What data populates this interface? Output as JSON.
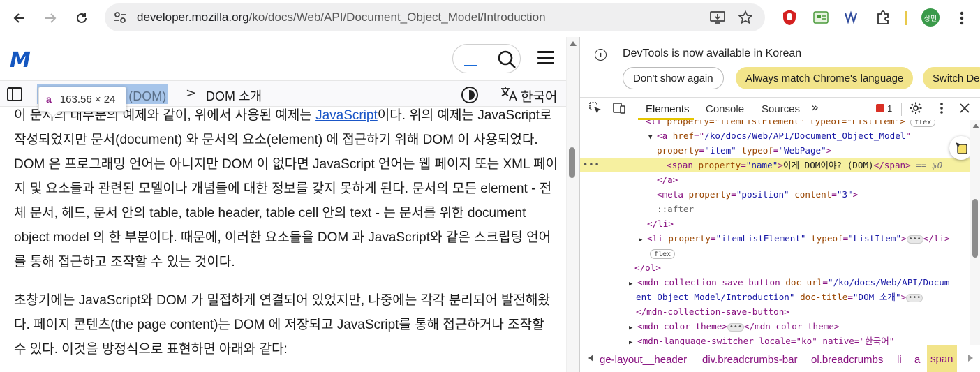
{
  "browser": {
    "url_host": "developer.mozilla.org",
    "url_path": "/ko/docs/Web/API/Document_Object_Model/Introduction",
    "avatar_text": "상민"
  },
  "page": {
    "logo_text": "M",
    "tooltip": {
      "tag": "a",
      "size": "163.56 × 24"
    },
    "breadcrumb": {
      "item1": "이게 DOM이야? (DOM)",
      "separator": ">",
      "item2": "DOM 소개"
    },
    "language_label": "한국어",
    "paragraph1": {
      "before_link": "이 문서의 대부분의 예제와 같이, 위에서 사용된 예제는 ",
      "link": "JavaScript",
      "after_link": "이다. 위의 예제는 JavaScript로 작성되었지만 문서(document) 와 문서의 요소(element) 에 접근하기 위해 DOM 이 사용되었다. DOM 은 프로그래밍 언어는 아니지만 DOM 이 없다면 JavaScript 언어는 웹 페이지 또는 XML 페이지 및 요소들과 관련된 모델이나 개념들에 대한 정보를 갖지 못하게 된다. 문서의 모든 element - 전체 문서, 헤드, 문서 안의 table, table header, table cell 안의 text - 는 문서를 위한 document object model 의 한 부분이다. 때문에, 이러한 요소들을 DOM 과 JavaScript와 같은 스크립팅 언어를 통해 접근하고 조작할 수 있는 것이다."
    },
    "paragraph2": "초창기에는 JavaScript와 DOM 가 밀접하게 연결되어 있었지만, 나중에는 각각 분리되어 발전해왔다. 페이지 콘텐츠(the page content)는 DOM 에 저장되고 JavaScript를 통해 접근하거나 조작할 수 있다. 이것을 방정식으로 표현하면 아래와 같다:"
  },
  "devtools": {
    "info_text": "DevTools is now available in Korean",
    "btn_dont_show": "Don't show again",
    "btn_always_match": "Always match Chrome's language",
    "btn_switch": "Switch De",
    "tabs": [
      "Elements",
      "Console",
      "Sources"
    ],
    "more_tabs": "»",
    "error_count": "1",
    "code": {
      "l0_tag": "<li",
      "l0_rest": " property=\"itemListElement\" typeof=\"ListItem\">",
      "l0_badge": "flex",
      "l1_open": "<a",
      "l1_attr1": " href",
      "l1_val1": "/ko/docs/Web/API/Document_Object_Model",
      "l2_attr1": "property",
      "l2_val1": "\"item\"",
      "l2_attr2": "typeof",
      "l2_val2": "\"WebPage\"",
      "l3_open": "<span",
      "l3_attr": "property",
      "l3_val": "\"name\"",
      "l3_text": "이게 DOM이야? (DOM)",
      "l3_close": "</span>",
      "l3_eq": "== $0",
      "l4": "</a>",
      "l5_open": "<meta",
      "l5_attr1": "property",
      "l5_val1": "\"position\"",
      "l5_attr2": "content",
      "l5_val2": "\"3\"",
      "l6": "::after",
      "l7": "</li>",
      "l8_open": "<li",
      "l8_attr1": "property",
      "l8_val1": "\"itemListElement\"",
      "l8_attr2": "typeof",
      "l8_val2": "\"ListItem\"",
      "l8_close": "</li>",
      "l9_badge": "flex",
      "l10": "</ol>",
      "l11_open": "<mdn-collection-save-button",
      "l11_attr1": "doc-url",
      "l11_val1": "\"/ko/docs/Web/API/Docum",
      "l12_val1": "ent_Object_Model/Introduction\"",
      "l12_attr2": "doc-title",
      "l12_val2": "\"DOM 소개\"",
      "l13": "</mdn-collection-save-button>",
      "l14_open": "<mdn-color-theme>",
      "l14_close": "</mdn-color-theme>",
      "l15": "<mdn-language-switcher locale=\"ko\" native=\"한국어\""
    },
    "crumbs": [
      "ge-layout__header",
      "div.breadcrumbs-bar",
      "ol.breadcrumbs",
      "li",
      "a",
      "span"
    ],
    "colors": {
      "selection": "#f6f0a0",
      "tag": "#881280",
      "attr_name": "#994500",
      "attr_value": "#1a1aa6",
      "accent": "#e5c500"
    }
  }
}
